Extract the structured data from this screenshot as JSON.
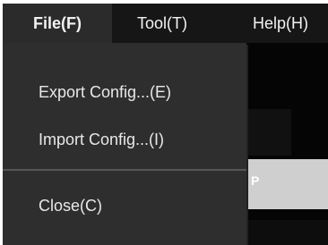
{
  "menubar": {
    "file": "File(F)",
    "tool": "Tool(T)",
    "help": "Help(H)"
  },
  "dropdown": {
    "items": [
      {
        "label": "Export Config...(E)"
      },
      {
        "label": "Import Config...(I)"
      },
      {
        "label": "Close(C)"
      }
    ]
  },
  "background": {
    "partial_text": "P"
  },
  "colors": {
    "menubar_bg": "#161616",
    "active_menu_bg": "#2b2b2b",
    "dropdown_bg": "#2e2e2e",
    "separator": "#565656",
    "text": "#e8e8e8"
  }
}
